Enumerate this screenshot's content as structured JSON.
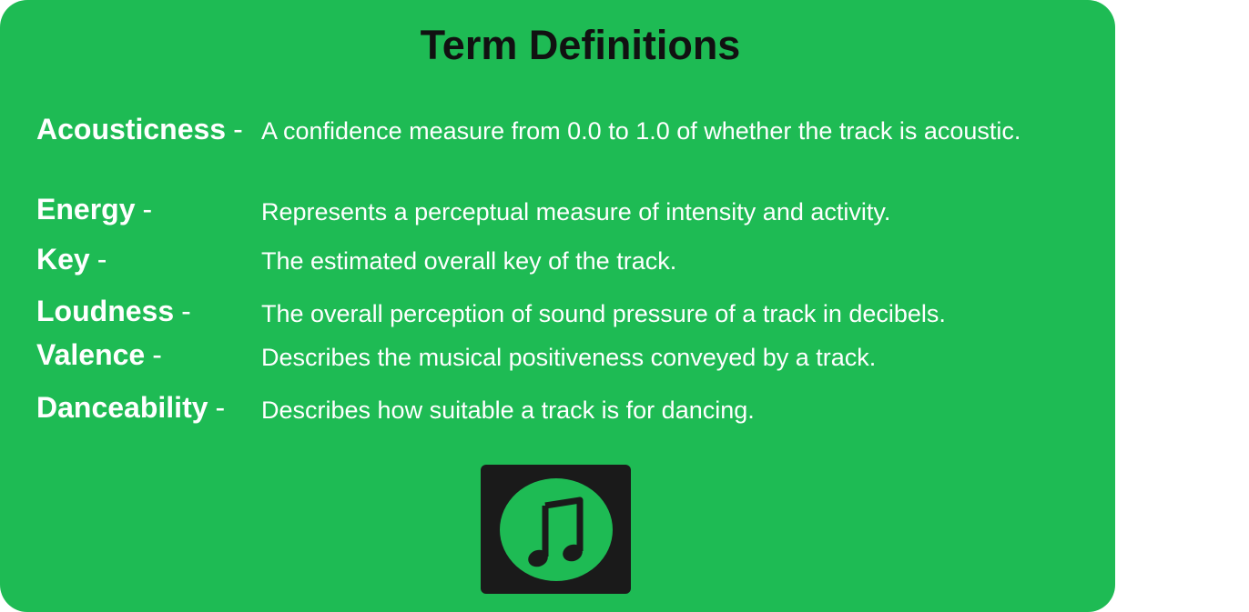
{
  "title": "Term Definitions",
  "terms": [
    {
      "term": "Acousticness",
      "dash": "-",
      "definition": "A confidence measure from 0.0 to 1.0 of whether the track is acoustic."
    },
    {
      "term": "Energy",
      "dash": "-",
      "definition": "Represents a perceptual measure of intensity and activity."
    },
    {
      "term": "Key",
      "dash": "-",
      "definition": "The estimated overall key of the track."
    },
    {
      "term": "Loudness",
      "dash": "-",
      "definition": "The overall perception of sound pressure of a track in decibels."
    },
    {
      "term": "Valence",
      "dash": "-",
      "definition": "Describes the musical positiveness conveyed by a track."
    },
    {
      "term": "Danceability",
      "dash": "-",
      "definition": "Describes how suitable a track is for dancing."
    }
  ],
  "logo": {
    "icon": "music-note-icon"
  },
  "colors": {
    "card_background": "#1ebb54",
    "text": "#ffffff",
    "title": "#111111",
    "logo_box": "#1a1a1a"
  }
}
